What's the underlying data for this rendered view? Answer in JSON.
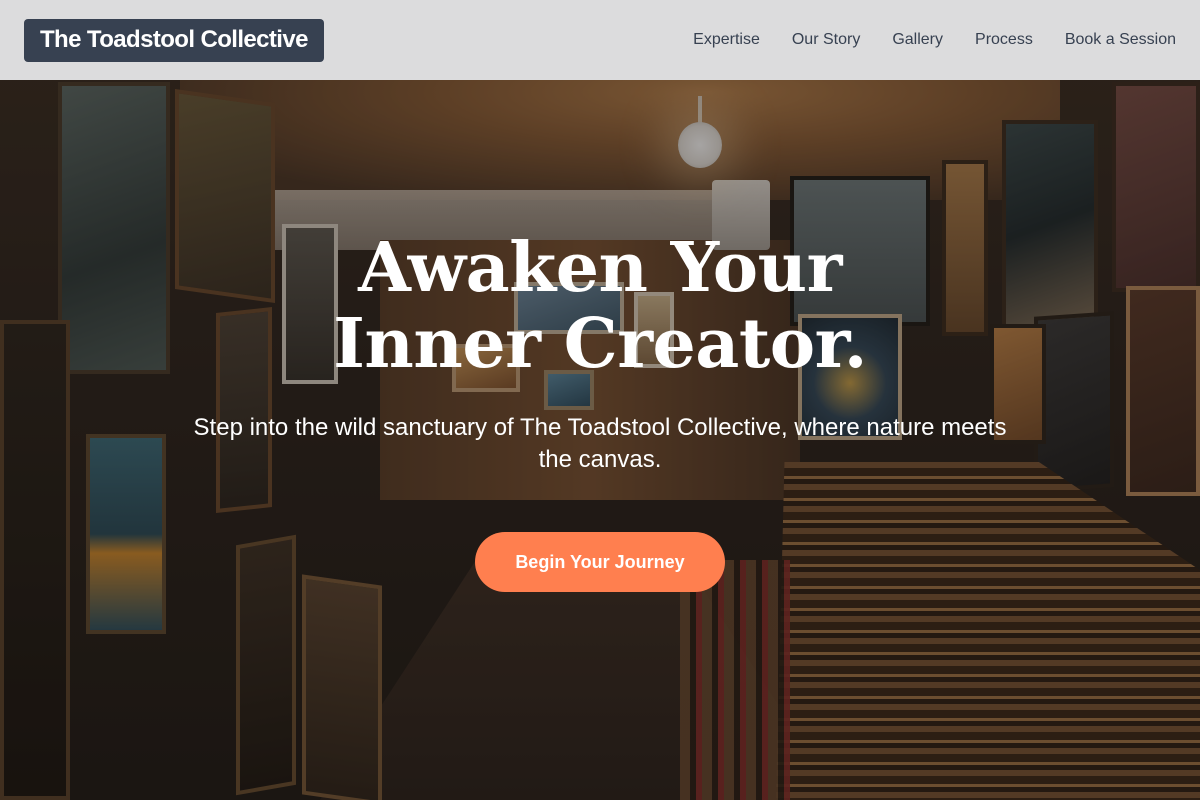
{
  "nav": {
    "brand": "The Toadstool Collective",
    "links": [
      "Expertise",
      "Our Story",
      "Gallery",
      "Process",
      "Book a Session"
    ]
  },
  "hero": {
    "headline": "Awaken Your Inner Creator.",
    "subheadline": "Step into the wild sanctuary of The Toadstool Collective, where nature meets the canvas.",
    "cta_label": "Begin Your Journey",
    "background_image": "art-gallery-storage-room-photo"
  },
  "colors": {
    "brand_bg": "#374151",
    "nav_bg": "#e8e8ea",
    "nav_text": "#374151",
    "cta_bg": "#ff7f4f",
    "hero_text": "#ffffff"
  }
}
